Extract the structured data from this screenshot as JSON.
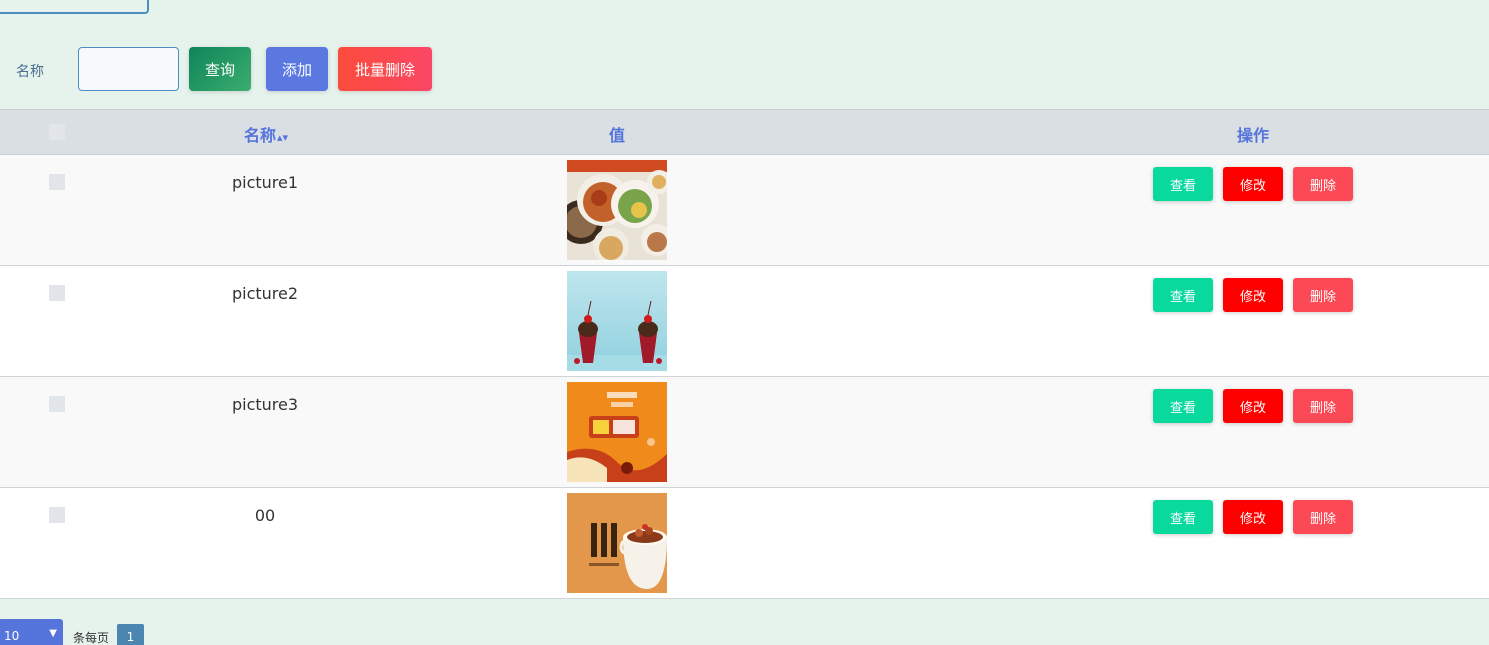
{
  "search": {
    "label": "名称",
    "input_value": "",
    "query_label": "查询",
    "add_label": "添加",
    "batch_delete_label": "批量删除"
  },
  "table": {
    "headers": {
      "name": "名称",
      "sort_icon": "sort-icon",
      "value": "值",
      "action": "操作"
    },
    "rows": [
      {
        "name": "picture1",
        "image": "food-dishes-banner"
      },
      {
        "name": "picture2",
        "image": "sundae-cups-banner"
      },
      {
        "name": "picture3",
        "image": "orange-snack-promo-banner"
      },
      {
        "name": "00",
        "image": "braised-pork-bowl-banner"
      }
    ],
    "row_actions": {
      "view": "查看",
      "edit": "修改",
      "delete": "删除"
    }
  },
  "pager": {
    "page_size": "10",
    "per_page_label": "条每页",
    "current_page": "1"
  },
  "colors": {
    "page_bg": "#e6f2ec",
    "header_text": "#5574dc",
    "view_btn": "#0ad99e",
    "edit_btn": "#ff0000",
    "delete_btn": "#fb4a55",
    "add_btn": "#5a78e0"
  }
}
